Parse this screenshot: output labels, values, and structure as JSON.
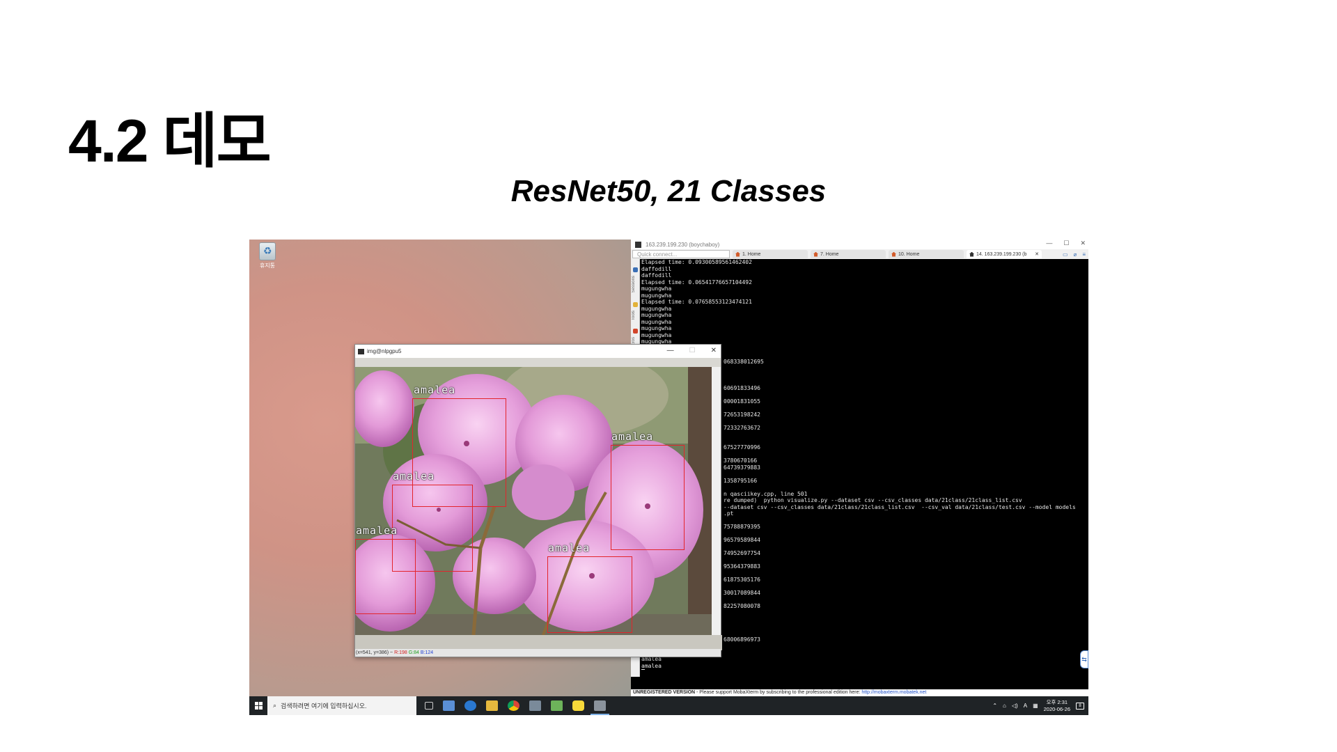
{
  "slide": {
    "title": "4.2 데모",
    "subtitle": "ResNet50, 21 Classes"
  },
  "desktop": {
    "recycle_bin_label": "휴지통"
  },
  "terminal": {
    "window_title": "163.239.199.230 (boychaboy)",
    "quick_connect_placeholder": "Quick connect...",
    "tabs": [
      {
        "label": "1. Home",
        "active": false
      },
      {
        "label": "7. Home",
        "active": false
      },
      {
        "label": "10. Home",
        "active": false
      },
      {
        "label": "14. 163.239.199.230 (b",
        "active": true
      }
    ],
    "sidebar_labels": [
      "Sessions",
      "Tools",
      "Macros"
    ],
    "lines": [
      "Elapsed time: 0.09300589561462402",
      "daffodill",
      "daffodill",
      "Elapsed time: 0.06541776657104492",
      "mugungwha",
      "mugungwha",
      "Elapsed time: 0.07658553123474121",
      "mugungwha",
      "mugungwha",
      "mugungwha",
      "mugungwha",
      "mugungwha",
      "mugungwha",
      "mugungwha"
    ],
    "partial_lines": [
      {
        "row": 15,
        "text": "068338012695"
      },
      {
        "row": 19,
        "text": "60691833496"
      },
      {
        "row": 21,
        "text": "00001831055"
      },
      {
        "row": 23,
        "text": "72653198242"
      },
      {
        "row": 25,
        "text": "72332763672"
      },
      {
        "row": 28,
        "text": "67527770996"
      },
      {
        "row": 30,
        "text": "3780670166"
      },
      {
        "row": 31,
        "text": "64739379883"
      },
      {
        "row": 33,
        "text": "1358795166"
      },
      {
        "row": 35,
        "text": "n qasciikey.cpp, line 501"
      },
      {
        "row": 36,
        "text": "re dumped)  python visualize.py --dataset csv --csv_classes data/21class/21class_list.csv"
      },
      {
        "row": 37,
        "text": "--dataset csv --csv_classes data/21class/21class_list.csv  --csv_val data/21class/test.csv --model models"
      },
      {
        "row": 38,
        "text": ".pt"
      },
      {
        "row": 40,
        "text": "75788879395"
      },
      {
        "row": 42,
        "text": "96579589844"
      },
      {
        "row": 44,
        "text": "74952697754"
      },
      {
        "row": 46,
        "text": "95364379883"
      },
      {
        "row": 48,
        "text": "61875305176"
      },
      {
        "row": 50,
        "text": "30017089844"
      },
      {
        "row": 52,
        "text": "82257080078"
      },
      {
        "row": 57,
        "text": "68006896973"
      }
    ],
    "tail_lines": [
      "amalea",
      "amalea"
    ],
    "status_bold": "UNREGISTERED VERSION",
    "status_text": "  -  Please support MobaXterm by subscribing to the professional edition here:",
    "status_link": "http://mobaxterm.mobatek.net"
  },
  "image_window": {
    "title": "img@nlpgpu5",
    "status_coords": "(x=541, y=386) ~",
    "status_r": "R:198",
    "status_g": "G:84",
    "status_b": "B:124",
    "detections": [
      {
        "label": "amalea"
      },
      {
        "label": "amalea"
      },
      {
        "label": "amalea"
      },
      {
        "label": "amalea"
      },
      {
        "label": "amalea"
      }
    ]
  },
  "taskbar": {
    "search_placeholder": "검색하려면 여기에 입력하십시오.",
    "time": "오후 2:31",
    "date": "2020-06-26",
    "ime": "A",
    "notif_count": "8"
  },
  "colors": {
    "bbox": "#e3242b",
    "taskbar": "#1f2326",
    "terminal_bg": "#000000"
  }
}
